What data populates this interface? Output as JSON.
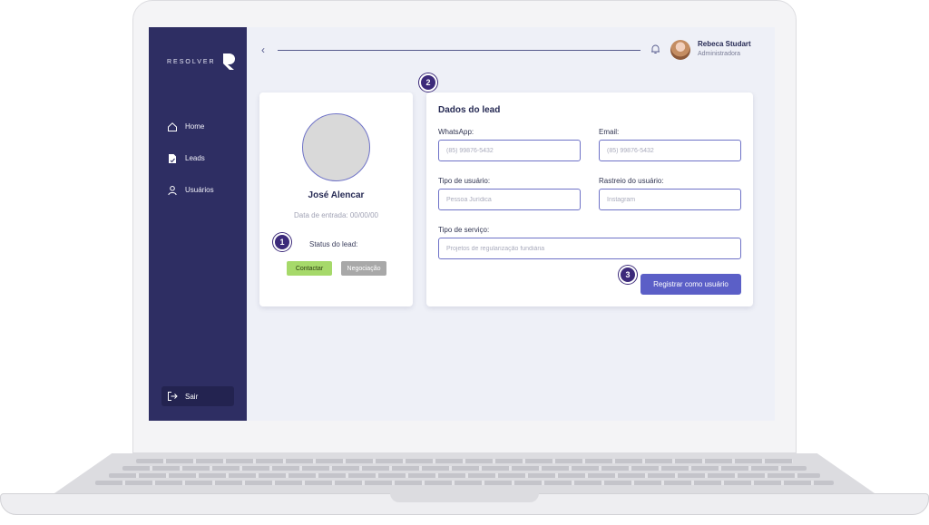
{
  "brand": {
    "name": "RESOLVER"
  },
  "sidebar": {
    "items": [
      {
        "label": "Home",
        "icon": "home-icon"
      },
      {
        "label": "Leads",
        "icon": "document-icon"
      },
      {
        "label": "Usuários",
        "icon": "user-icon"
      }
    ],
    "logout_label": "Sair"
  },
  "header": {
    "user_name": "Rebeca Studart",
    "user_role": "Administradora"
  },
  "lead": {
    "name": "José Alencar",
    "entry_date": "Data de entrada: 00/00/00",
    "status_label": "Status do lead:",
    "status_buttons": [
      "Contactar",
      "Negociação"
    ]
  },
  "form": {
    "title": "Dados do lead",
    "whatsapp": {
      "label": "WhatsApp:",
      "placeholder": "(85) 99876-5432"
    },
    "email": {
      "label": "Email:",
      "placeholder": "(85) 99876-5432"
    },
    "user_type": {
      "label": "Tipo de usuário:",
      "placeholder": "Pessoa Jurídica"
    },
    "user_tracking": {
      "label": "Rastreio do usuário:",
      "placeholder": "Instagram"
    },
    "service_type": {
      "label": "Tipo de serviço:",
      "placeholder": "Projetos de regularização fundiária"
    },
    "submit_label": "Registrar como usuário"
  },
  "steps": [
    "1",
    "2",
    "3"
  ],
  "colors": {
    "sidebar": "#2e2e63",
    "accent": "#5b5fc7",
    "contact_button": "#a6d96a",
    "negotiation_button": "#a8a8a8",
    "step_badge": "#3c2a7a"
  }
}
